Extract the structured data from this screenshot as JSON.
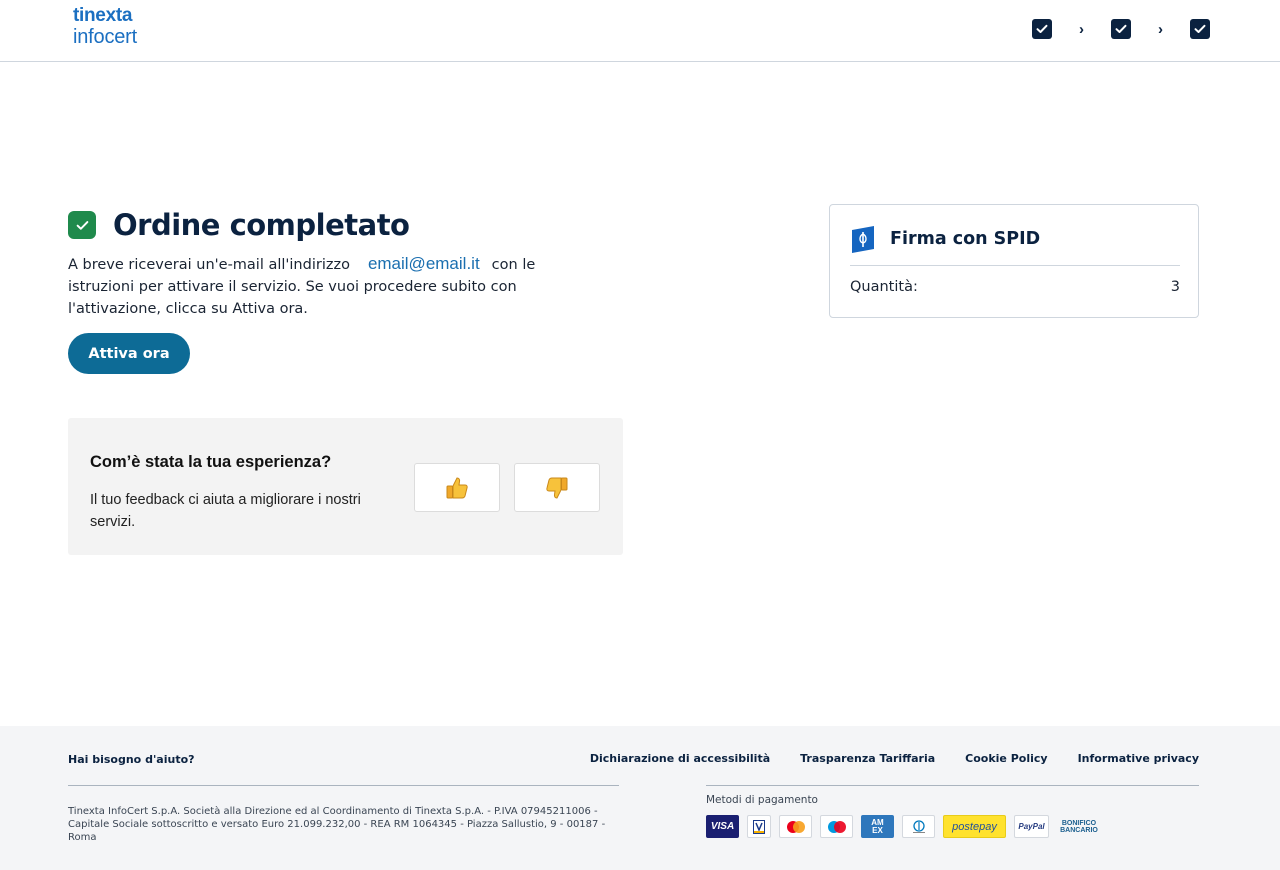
{
  "header": {
    "logo_line1": "tinexta",
    "logo_line2": "infocert",
    "steps": [
      "completed",
      "completed",
      "completed"
    ]
  },
  "main": {
    "title": "Ordine completato",
    "description_before": "A breve riceverai un'e-mail all'indirizzo",
    "email": "email@email.it",
    "description_after": "con le istruzioni per attivare il servizio. Se vuoi procedere subito con l'attivazione, clicca su Attiva ora.",
    "activate_button": "Attiva ora"
  },
  "feedback": {
    "title": "Com’è stata la tua esperienza?",
    "text": "Il tuo feedback ci aiuta a migliorare i nostri servizi.",
    "thumbs_up": "👍",
    "thumbs_down": "👎"
  },
  "summary": {
    "product_title": "Firma con SPID",
    "quantity_label": "Quantità:",
    "quantity_value": "3"
  },
  "footer": {
    "help": "Hai bisogno d'aiuto?",
    "links": [
      "Dichiarazione di accessibilità",
      "Trasparenza Tariffaria",
      "Cookie Policy",
      "Informative privacy"
    ],
    "legal": "Tinexta InfoCert S.p.A. Società alla Direzione ed al Coordinamento di Tinexta S.p.A. - P.IVA 07945211006 - Capitale Sociale sottoscritto e versato Euro 21.099.232,00 - REA RM 1064345 - Piazza Sallustio, 9 - 00187 - Roma",
    "payment_label": "Metodi di pagamento",
    "payment_methods": {
      "visa": "VISA",
      "amex_line1": "AM",
      "amex_line2": "EX",
      "postepay": "postepay",
      "paypal": "PayPal",
      "bonifico_line1": "BONIFICO",
      "bonifico_line2": "BANCARIO"
    }
  },
  "colors": {
    "navy": "#0b2240",
    "brand_blue": "#1b6fc1",
    "primary_button": "#0d6b96",
    "success": "#1f8a4c",
    "footer_bg": "#f4f5f7"
  }
}
